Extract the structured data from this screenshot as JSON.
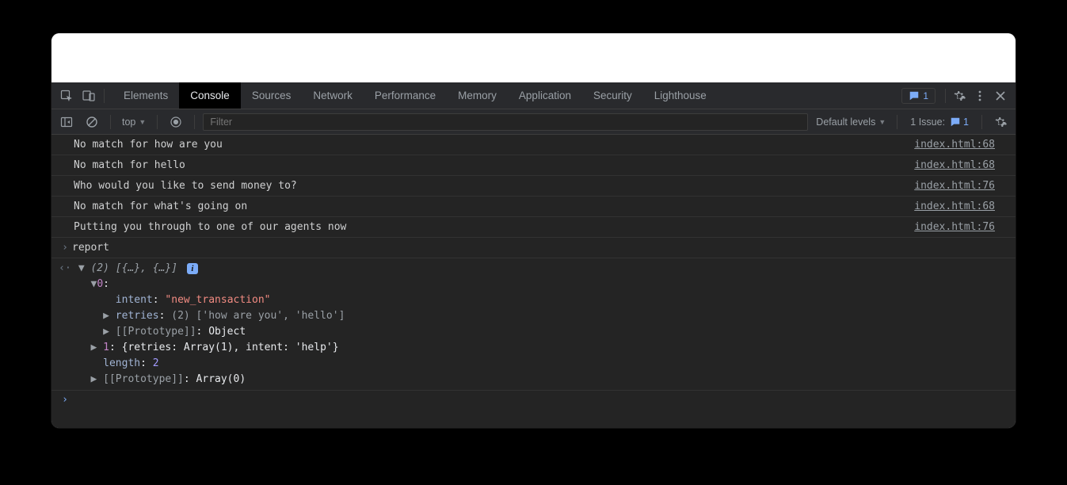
{
  "tabs": {
    "items": [
      "Elements",
      "Console",
      "Sources",
      "Network",
      "Performance",
      "Memory",
      "Application",
      "Security",
      "Lighthouse"
    ],
    "active_index": 1
  },
  "header": {
    "messages_badge": "1"
  },
  "toolbar": {
    "context": "top",
    "filter_placeholder": "Filter",
    "levels": "Default levels",
    "issues_label": "1 Issue:",
    "issues_count": "1"
  },
  "logs": [
    {
      "msg": "No match for how are you",
      "src": "index.html:68"
    },
    {
      "msg": "No match for hello",
      "src": "index.html:68"
    },
    {
      "msg": "Who would you like to send money to?",
      "src": "index.html:76"
    },
    {
      "msg": "No match for what's going on",
      "src": "index.html:68"
    },
    {
      "msg": "Putting you through to one of our agents now",
      "src": "index.html:76"
    }
  ],
  "input": {
    "text": "report"
  },
  "output": {
    "summary_count": "(2)",
    "summary_preview": "[{…}, {…}]",
    "item0": {
      "index": "0",
      "intent_key": "intent",
      "intent_value": "\"new_transaction\"",
      "retries_key": "retries",
      "retries_preview": "(2) ['how are you', 'hello']",
      "proto_label": "[[Prototype]]",
      "proto_value": "Object"
    },
    "item1": {
      "index": "1",
      "preview": "{retries: Array(1), intent: 'help'}"
    },
    "length_key": "length",
    "length_value": "2",
    "proto2_label": "[[Prototype]]",
    "proto2_value": "Array(0)"
  }
}
